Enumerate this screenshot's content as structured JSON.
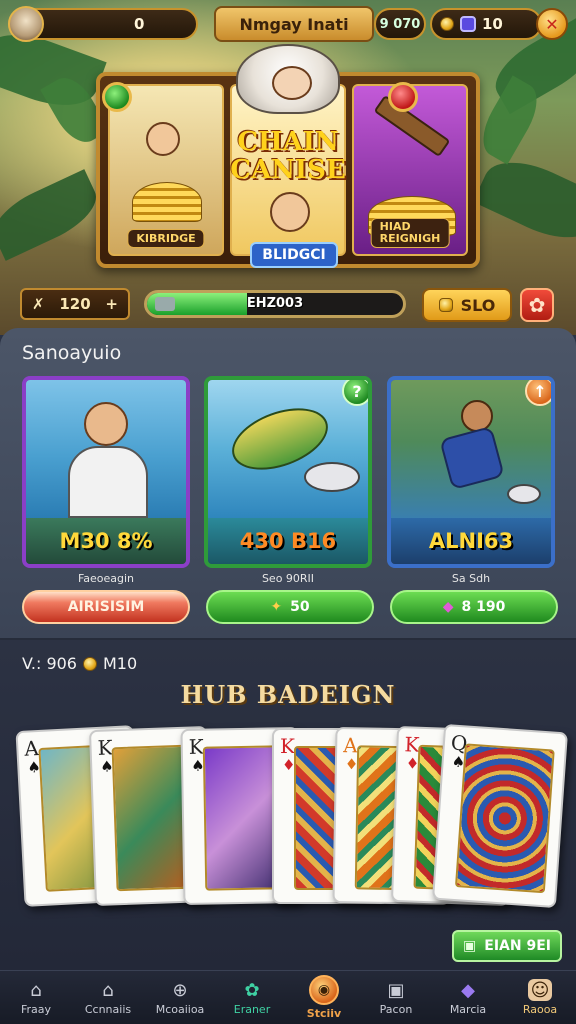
{
  "hud": {
    "currency_left": "0",
    "title": "Nmgay Inati",
    "coins": "9 070",
    "gems": "10",
    "avatar_icon": "player-avatar",
    "close_icon": "close-icon"
  },
  "slot": {
    "center_title": "CHAIN CANISE",
    "center_sub": "BLIDGCI",
    "left_tag": "KIBRIDGE",
    "right_tag": "HIAD\nREIGNIGH"
  },
  "status": {
    "stat_value": "120",
    "progress_label": "EHZ003",
    "progress_fraction": 0.39,
    "slo_label": "SLO"
  },
  "section": {
    "title": "Sanoayuio",
    "cards": [
      {
        "price": "M30 8%",
        "caption": "Faeoeagin",
        "button": "AIRISISIM",
        "accent": "#8b3fc7"
      },
      {
        "price": "430 B16",
        "caption": "Seo 90RII",
        "button": "50",
        "badge": "?",
        "accent": "#2f9b3a"
      },
      {
        "price": "ALNI63",
        "caption": "Sa Sdh",
        "button": "8 190",
        "badge": "↑",
        "accent": "#3b6fc9"
      }
    ]
  },
  "lower": {
    "wallet_prefix": "V.: 906",
    "wallet_suffix": "M10",
    "hub_title": "HUB BADEIGN",
    "cards": [
      {
        "rank": "A",
        "suit": "♠"
      },
      {
        "rank": "K",
        "suit": "♠"
      },
      {
        "rank": "K",
        "suit": "♠"
      },
      {
        "rank": "K",
        "suit": "♦"
      },
      {
        "rank": "A",
        "suit": "♦"
      },
      {
        "rank": "K",
        "suit": "♦"
      },
      {
        "rank": "Q",
        "suit": "♠"
      }
    ],
    "claim_label": "EIAN 9EI"
  },
  "nav": [
    {
      "label": "Fraay",
      "icon": "home-icon"
    },
    {
      "label": "Ccnnaiis",
      "icon": "building-icon"
    },
    {
      "label": "Mcoaiioa",
      "icon": "globe-icon"
    },
    {
      "label": "Eraner",
      "icon": "gear-icon"
    },
    {
      "label": "Stciiv",
      "icon": "bowl-icon"
    },
    {
      "label": "Pacon",
      "icon": "camera-icon"
    },
    {
      "label": "Marcia",
      "icon": "gem-icon"
    },
    {
      "label": "Raooa",
      "icon": "cat-icon"
    }
  ]
}
